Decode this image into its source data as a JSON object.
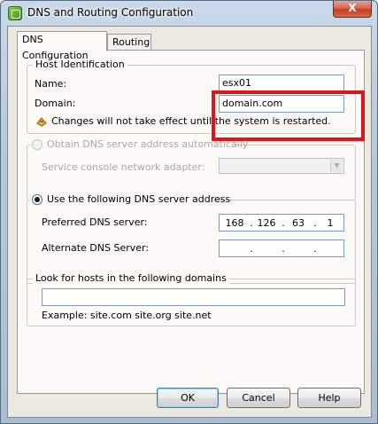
{
  "window": {
    "title": "DNS and Routing Configuration",
    "close_label": "X"
  },
  "tabs": [
    {
      "label": "DNS Configuration",
      "active": true
    },
    {
      "label": "Routing",
      "active": false
    }
  ],
  "host_identification": {
    "title": "Host Identification",
    "name_label": "Name:",
    "name_value": "esx01",
    "domain_label": "Domain:",
    "domain_value": "domain.com",
    "warning": "Changes will not take effect until the system is restarted."
  },
  "dns_auto": {
    "radio_label": "Obtain DNS server address automatically",
    "adapter_label": "Service console network adapter:",
    "adapter_value": ""
  },
  "dns_manual": {
    "radio_label": "Use the following DNS server address",
    "preferred_label": "Preferred DNS server:",
    "preferred_octets": [
      "168",
      "126",
      "63",
      "1"
    ],
    "alternate_label": "Alternate DNS Server:",
    "alternate_octets": [
      "",
      "",
      "",
      ""
    ]
  },
  "search_domains": {
    "title": "Look for hosts in the following domains",
    "value": "",
    "example": "Example: site.com site.org site.net"
  },
  "buttons": {
    "ok": "OK",
    "cancel": "Cancel",
    "help": "Help"
  },
  "colors": {
    "highlight": "#e0151b",
    "titlebar": "#b8cadd",
    "dialog_bg": "#ece9e1"
  }
}
